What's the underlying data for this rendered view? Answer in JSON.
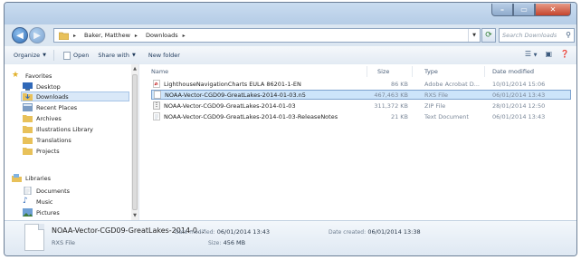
{
  "window": {
    "caption": {
      "minimize": "–",
      "maximize": "▭",
      "close": "✕"
    }
  },
  "address": {
    "crumbs": [
      "Baker, Matthew",
      "Downloads"
    ]
  },
  "search": {
    "placeholder": "Search Downloads"
  },
  "toolbar": {
    "organize": "Organize",
    "open": "Open",
    "share_with": "Share with",
    "new_folder": "New folder"
  },
  "nav": {
    "favorites_header": "Favorites",
    "favorites": [
      "Desktop",
      "Downloads",
      "Recent Places",
      "Archives",
      "Illustrations Library",
      "Translations",
      "Projects"
    ],
    "libraries_header": "Libraries",
    "libraries": [
      "Documents",
      "Music",
      "Pictures"
    ]
  },
  "columns": {
    "name": "Name",
    "size": "Size",
    "type": "Type",
    "date_modified": "Date modified"
  },
  "files": [
    {
      "name": "LighthouseNavigationCharts EULA 86201-1-EN",
      "size": "86 KB",
      "type": "Adobe Acrobat D...",
      "date": "10/01/2014 15:06",
      "icon": "pdf-icon",
      "selected": false
    },
    {
      "name": "NOAA-Vector-CGD09-GreatLakes-2014-01-03.n5",
      "size": "467,463 KB",
      "type": "RXS File",
      "date": "06/01/2014 13:43",
      "icon": "file-icon",
      "selected": true
    },
    {
      "name": "NOAA-Vector-CGD09-GreatLakes-2014-01-03",
      "size": "311,372 KB",
      "type": "ZIP File",
      "date": "28/01/2014 12:50",
      "icon": "zip-icon",
      "selected": false
    },
    {
      "name": "NOAA-Vector-CGD09-GreatLakes-2014-01-03-ReleaseNotes",
      "size": "21 KB",
      "type": "Text Document",
      "date": "06/01/2014 13:43",
      "icon": "text-file-icon",
      "selected": false
    }
  ],
  "details": {
    "name": "NOAA-Vector-CGD09-GreatLakes-2014-0...",
    "type": "RXS File",
    "modified_label": "Date modified:",
    "modified_value": "06/01/2014 13:43",
    "size_label": "Size:",
    "size_value": "456 MB",
    "created_label": "Date created:",
    "created_value": "06/01/2014 13:38"
  }
}
